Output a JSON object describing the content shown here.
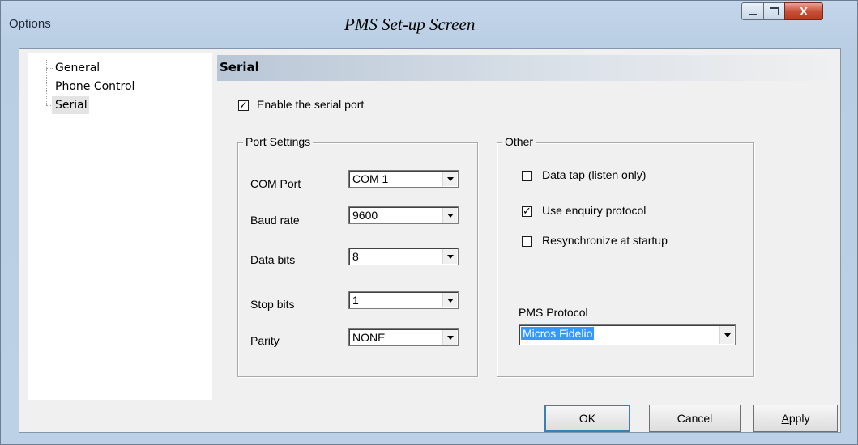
{
  "window": {
    "title": "Options",
    "caption": "PMS Set-up Screen",
    "controls": {
      "minimize": "minimize-icon",
      "maximize": "maximize-icon",
      "close": "X"
    }
  },
  "tree": {
    "items": [
      {
        "label": "General"
      },
      {
        "label": "Phone Control"
      },
      {
        "label": "Serial",
        "selected": true
      }
    ]
  },
  "section": {
    "title": "Serial"
  },
  "enable_serial": {
    "label": "Enable the serial port",
    "checked": true
  },
  "port_settings": {
    "caption": "Port Settings",
    "fields": [
      {
        "label": "COM Port",
        "value": "COM 1"
      },
      {
        "label": "Baud rate",
        "value": "9600"
      },
      {
        "label": "Data bits",
        "value": "8"
      },
      {
        "label": "Stop bits",
        "value": "1"
      },
      {
        "label": "Parity",
        "value": "NONE"
      }
    ]
  },
  "other": {
    "caption": "Other",
    "options": [
      {
        "label": "Data tap (listen only)",
        "checked": false
      },
      {
        "label": "Use enquiry protocol",
        "checked": true
      },
      {
        "label": "Resynchronize at startup",
        "checked": false
      }
    ],
    "pms_protocol": {
      "label": "PMS Protocol",
      "value": "Micros Fidelio"
    }
  },
  "buttons": {
    "ok": "OK",
    "cancel": "Cancel",
    "apply_first": "A",
    "apply_rest": "pply"
  }
}
